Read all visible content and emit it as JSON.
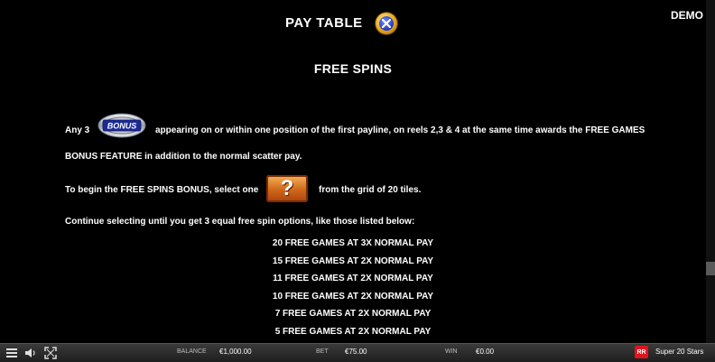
{
  "header": {
    "title": "PAY TABLE",
    "close_icon": "close-x-icon",
    "mode": "DEMO"
  },
  "section_title": "FREE SPINS",
  "paragraphs": {
    "p1_prefix": "Any 3",
    "p1_suffix": "appearing on or within one position of the first payline, on reels 2,3 & 4 at the same time awards the FREE GAMES",
    "p1_line2": "BONUS FEATURE in addition to the normal scatter pay.",
    "p2_prefix": "To begin the FREE SPINS BONUS, select one",
    "p2_suffix": "from the grid of 20 tiles.",
    "p3": "Continue selecting until you get 3 equal free spin options, like those listed below:"
  },
  "bonus_symbol_text": "BONUS",
  "question_tile_text": "?",
  "free_games": [
    "20 FREE GAMES AT 3X NORMAL PAY",
    "15 FREE GAMES AT 2X NORMAL PAY",
    "11 FREE GAMES AT 2X NORMAL PAY",
    "10 FREE GAMES AT 2X NORMAL PAY",
    "7 FREE GAMES AT 2X NORMAL PAY",
    "5 FREE GAMES AT 2X NORMAL PAY"
  ],
  "bottom_bar": {
    "menu_icon": "hamburger-menu-icon",
    "sound_icon": "speaker-icon",
    "fullscreen_icon": "fullscreen-icon",
    "balance_label": "BALANCE",
    "balance_value": "€1,000.00",
    "bet_label": "BET",
    "bet_value": "€75.00",
    "win_label": "WIN",
    "win_value": "€0.00",
    "brand_logo_text": "RR",
    "game_name": "Super 20 Stars"
  },
  "colors": {
    "background": "#000000",
    "text": "#ffffff",
    "close_ring": "#e6a51a",
    "close_center": "#2338b8",
    "question_tile": "#d0661a",
    "brand_red": "#e0141e"
  }
}
